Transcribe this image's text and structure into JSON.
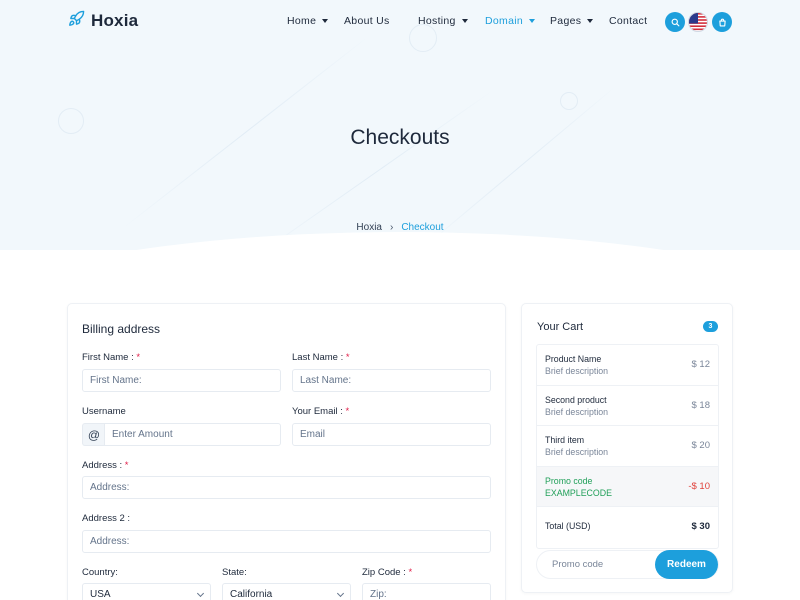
{
  "brand": {
    "name": "Hoxia",
    "accent": "#1d9fdc"
  },
  "nav": {
    "items": [
      {
        "label": "Home",
        "dropdown": true,
        "active": false
      },
      {
        "label": "About Us",
        "dropdown": false,
        "active": false
      },
      {
        "label": "Hosting",
        "dropdown": true,
        "active": false
      },
      {
        "label": "Domain",
        "dropdown": true,
        "active": true
      },
      {
        "label": "Pages",
        "dropdown": true,
        "active": false
      },
      {
        "label": "Contact",
        "dropdown": false,
        "active": false
      }
    ],
    "icons": [
      "search-icon",
      "us-flag-icon",
      "shopping-bag-icon"
    ]
  },
  "page": {
    "title": "Checkouts"
  },
  "breadcrumb": {
    "home": "Hoxia",
    "separator": "›",
    "current": "Checkout"
  },
  "billing": {
    "title": "Billing address",
    "required_mark": "*",
    "first_name": {
      "label": "First Name :",
      "placeholder": "First Name:"
    },
    "last_name": {
      "label": "Last Name :",
      "placeholder": "Last Name:"
    },
    "username": {
      "label": "Username",
      "prefix": "@",
      "placeholder": "Enter Amount"
    },
    "email": {
      "label": "Your Email :",
      "placeholder": "Email"
    },
    "address": {
      "label": "Address :",
      "placeholder": "Address:"
    },
    "address2": {
      "label": "Address 2 :",
      "placeholder": "Address:"
    },
    "country": {
      "label": "Country:",
      "value": "USA"
    },
    "state": {
      "label": "State:",
      "value": "California"
    },
    "zip": {
      "label": "Zip Code :",
      "placeholder": "Zip:"
    }
  },
  "cart": {
    "title": "Your Cart",
    "count": "3",
    "items": [
      {
        "name": "Product Name",
        "desc": "Brief description",
        "price": "$ 12"
      },
      {
        "name": "Second product",
        "desc": "Brief description",
        "price": "$ 18"
      },
      {
        "name": "Third item",
        "desc": "Brief description",
        "price": "$ 20"
      }
    ],
    "promo": {
      "name": "Promo code",
      "code": "EXAMPLECODE",
      "discount": "-$ 10"
    },
    "total": {
      "label": "Total (USD)",
      "value": "$ 30"
    },
    "promo_input": {
      "placeholder": "Promo code"
    },
    "redeem_label": "Redeem"
  }
}
